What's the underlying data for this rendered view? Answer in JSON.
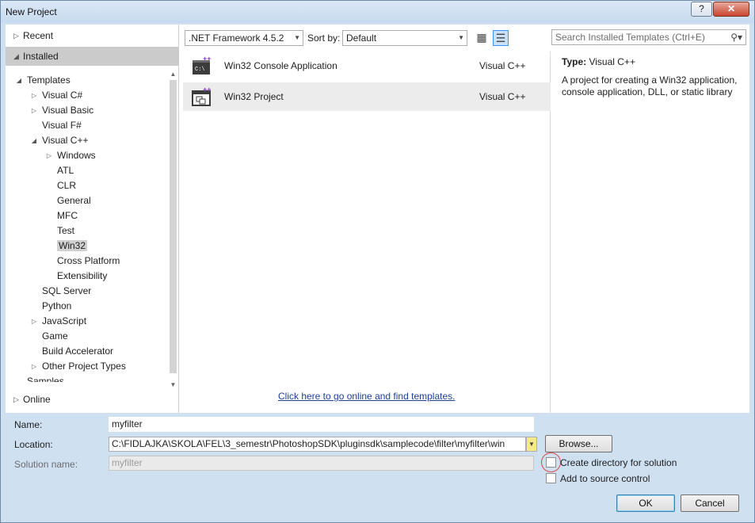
{
  "window": {
    "title": "New Project",
    "help_label": "?",
    "close_label": "✕"
  },
  "left": {
    "recent": "Recent",
    "installed": "Installed",
    "online": "Online",
    "tree": [
      {
        "label": "Templates",
        "level": 0,
        "expander": "expanded"
      },
      {
        "label": "Visual C#",
        "level": 1,
        "expander": "collapsed"
      },
      {
        "label": "Visual Basic",
        "level": 1,
        "expander": "collapsed"
      },
      {
        "label": "Visual F#",
        "level": 1,
        "expander": "none"
      },
      {
        "label": "Visual C++",
        "level": 1,
        "expander": "expanded"
      },
      {
        "label": "Windows",
        "level": 2,
        "expander": "collapsed"
      },
      {
        "label": "ATL",
        "level": 2,
        "expander": "none"
      },
      {
        "label": "CLR",
        "level": 2,
        "expander": "none"
      },
      {
        "label": "General",
        "level": 2,
        "expander": "none"
      },
      {
        "label": "MFC",
        "level": 2,
        "expander": "none"
      },
      {
        "label": "Test",
        "level": 2,
        "expander": "none"
      },
      {
        "label": "Win32",
        "level": 2,
        "expander": "none",
        "selected": true
      },
      {
        "label": "Cross Platform",
        "level": 2,
        "expander": "none"
      },
      {
        "label": "Extensibility",
        "level": 2,
        "expander": "none"
      },
      {
        "label": "SQL Server",
        "level": 1,
        "expander": "none"
      },
      {
        "label": "Python",
        "level": 1,
        "expander": "none"
      },
      {
        "label": "JavaScript",
        "level": 1,
        "expander": "collapsed"
      },
      {
        "label": "Game",
        "level": 1,
        "expander": "none"
      },
      {
        "label": "Build Accelerator",
        "level": 1,
        "expander": "none"
      },
      {
        "label": "Other Project Types",
        "level": 1,
        "expander": "collapsed"
      },
      {
        "label": "Samples",
        "level": 0,
        "expander": "none"
      }
    ]
  },
  "toolbar": {
    "framework": ".NET Framework 4.5.2",
    "sort_label": "Sort by:",
    "sort_value": "Default",
    "view": "list"
  },
  "search": {
    "placeholder": "Search Installed Templates (Ctrl+E)"
  },
  "templates": [
    {
      "name": "Win32 Console Application",
      "language": "Visual C++",
      "icon": "console-app-icon"
    },
    {
      "name": "Win32 Project",
      "language": "Visual C++",
      "icon": "win32-project-icon",
      "selected": true
    }
  ],
  "online_link": "Click here to go online and find templates.",
  "details": {
    "type_label": "Type:",
    "type_value": "Visual C++",
    "description": "A project for creating a Win32 application, console application, DLL, or static library"
  },
  "form": {
    "name_label": "Name:",
    "name_value": "myfilter",
    "location_label": "Location:",
    "location_value": "C:\\FIDLAJKA\\SKOLA\\FEL\\3_semestr\\PhotoshopSDK\\pluginsdk\\samplecode\\filter\\myfilter\\win",
    "solution_label": "Solution name:",
    "solution_value": "myfilter",
    "browse_label": "Browse...",
    "create_dir_label": "Create directory for solution",
    "create_dir_checked": false,
    "source_control_label": "Add to source control",
    "source_control_checked": false
  },
  "buttons": {
    "ok": "OK",
    "cancel": "Cancel"
  },
  "colors": {
    "selection": "#d0d0d0",
    "link": "#1c3f94",
    "highlight_ring": "#e04a4a"
  }
}
